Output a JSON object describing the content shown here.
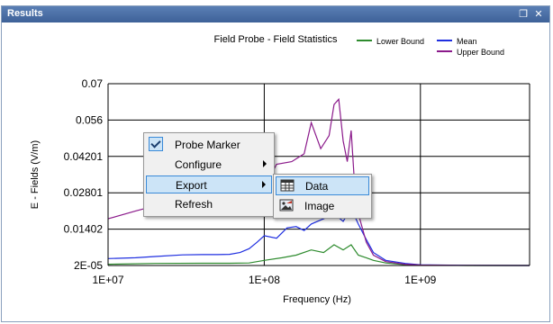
{
  "window": {
    "title": "Results",
    "restore_glyph": "❐",
    "close_glyph": "✕"
  },
  "chart_data": {
    "type": "line",
    "title": "Field Probe - Field Statistics",
    "xlabel": "Frequency (Hz)",
    "ylabel": "E - Fields (V/m)",
    "x_scale": "log",
    "xlim": [
      10000000,
      5000000000
    ],
    "ylim": [
      2e-05,
      0.07
    ],
    "x_ticks": [
      "1E+07",
      "1E+08",
      "1E+09"
    ],
    "y_ticks": [
      "2E-05",
      "0.01402",
      "0.02801",
      "0.04201",
      "0.056",
      "0.07"
    ],
    "grid": true,
    "legend_position": "top-right",
    "series": [
      {
        "name": "Lower Bound",
        "color": "#2e8b2e",
        "x": [
          10000000,
          20000000,
          40000000,
          60000000,
          80000000,
          100000000,
          130000000,
          160000000,
          200000000,
          240000000,
          280000000,
          320000000,
          360000000,
          400000000,
          450000000,
          500000000,
          600000000,
          800000000,
          1000000000,
          2000000000,
          5000000000
        ],
        "y": [
          0.0005,
          0.0008,
          0.0009,
          0.0009,
          0.001,
          0.002,
          0.003,
          0.004,
          0.006,
          0.005,
          0.008,
          0.006,
          0.008,
          0.004,
          0.003,
          0.002,
          0.001,
          0.0003,
          0.0001,
          2e-05,
          2e-05
        ]
      },
      {
        "name": "Mean",
        "color": "#1f2fe0",
        "x": [
          10000000,
          15000000,
          20000000,
          30000000,
          40000000,
          50000000,
          60000000,
          70000000,
          80000000,
          90000000,
          100000000,
          120000000,
          140000000,
          160000000,
          180000000,
          200000000,
          240000000,
          280000000,
          320000000,
          360000000,
          400000000,
          450000000,
          500000000,
          600000000,
          800000000,
          1000000000,
          2000000000,
          5000000000
        ],
        "y": [
          0.0027,
          0.003,
          0.0035,
          0.0041,
          0.0042,
          0.0042,
          0.0043,
          0.005,
          0.0065,
          0.009,
          0.0115,
          0.0105,
          0.0145,
          0.015,
          0.0135,
          0.016,
          0.018,
          0.02,
          0.017,
          0.022,
          0.016,
          0.01,
          0.005,
          0.002,
          0.0008,
          0.0003,
          5e-05,
          2e-05
        ]
      },
      {
        "name": "Upper Bound",
        "color": "#8b1a8b",
        "x": [
          10000000,
          15000000,
          20000000,
          30000000,
          40000000,
          60000000,
          80000000,
          100000000,
          120000000,
          150000000,
          180000000,
          200000000,
          230000000,
          260000000,
          280000000,
          300000000,
          320000000,
          340000000,
          360000000,
          380000000,
          400000000,
          450000000,
          500000000,
          600000000,
          800000000,
          1000000000,
          2000000000,
          5000000000
        ],
        "y": [
          0.018,
          0.021,
          0.023,
          0.024,
          0.025,
          0.025,
          0.026,
          0.03,
          0.039,
          0.04,
          0.043,
          0.055,
          0.045,
          0.05,
          0.062,
          0.064,
          0.048,
          0.04,
          0.052,
          0.03,
          0.02,
          0.009,
          0.004,
          0.0015,
          0.0005,
          0.0002,
          4e-05,
          2e-05
        ]
      }
    ]
  },
  "context_menu": {
    "items": [
      {
        "label": "Probe Marker",
        "checked": true,
        "submenu": false
      },
      {
        "label": "Configure",
        "checked": false,
        "submenu": true
      },
      {
        "label": "Export",
        "checked": false,
        "submenu": true
      },
      {
        "label": "Refresh",
        "checked": false,
        "submenu": false
      }
    ]
  },
  "export_submenu": {
    "items": [
      {
        "label": "Data",
        "icon": "data-table-icon"
      },
      {
        "label": "Image",
        "icon": "image-icon"
      }
    ]
  },
  "colors": {
    "title_bar": "#4a6fa8",
    "menu_highlight": "#cce4f7",
    "menu_highlight_border": "#3a8ad8"
  }
}
